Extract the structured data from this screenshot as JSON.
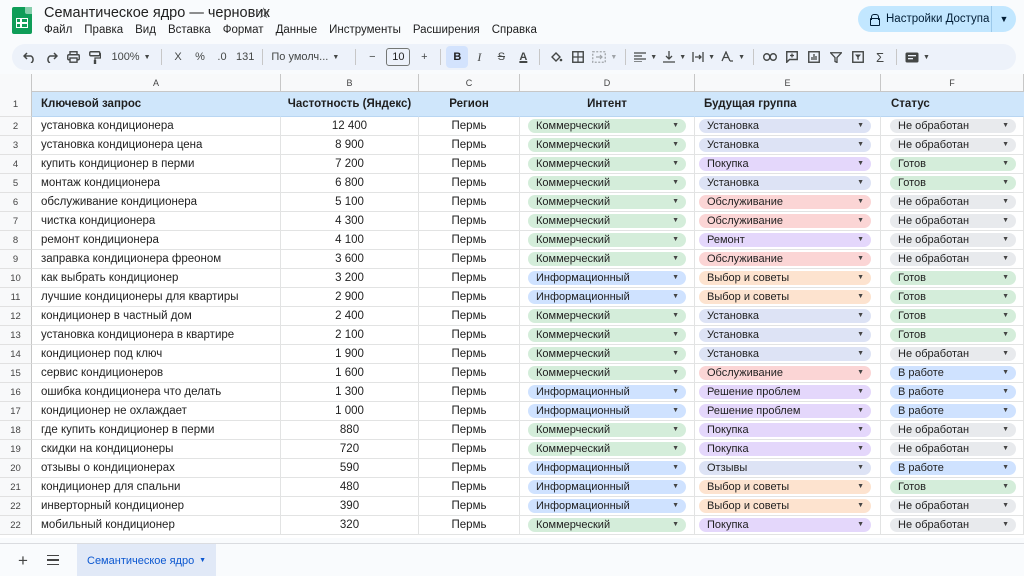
{
  "app": {
    "title": "Семантическое ядро — черновик",
    "menu": [
      "Файл",
      "Правка",
      "Вид",
      "Вставка",
      "Формат",
      "Данные",
      "Инструменты",
      "Расширения",
      "Справка"
    ],
    "share_label": "Настройки Доступа"
  },
  "toolbar": {
    "zoom": "100%",
    "currency": "X",
    "percent": "%",
    "decimals": ".0",
    "number_format": "131",
    "font": "По умолч...",
    "font_size": "10",
    "bold": "B",
    "italic": "I",
    "strike": "S",
    "text_color": "A"
  },
  "columns": [
    "A",
    "B",
    "C",
    "D",
    "E",
    "F"
  ],
  "header": {
    "num": "1",
    "keyword": "Ключевой запрос",
    "frequency": "Частотность (Яндекс)",
    "region": "Регион",
    "intent": "Интент",
    "group": "Будущая группа",
    "status": "Статус"
  },
  "chip_colors": {
    "Коммерческий": "#d4edda",
    "Информационный": "#cfe2ff",
    "Установка": "#dde3f5",
    "Покупка": "#e4d7fb",
    "Обслуживание": "#fbd5d5",
    "Ремонт": "#e4d7fb",
    "Выбор и советы": "#fde3cf",
    "Решение проблем": "#e4d7fb",
    "Отзывы": "#dde3f5",
    "Не обработан": "#e8eaed",
    "Готов": "#d4edda",
    "В работе": "#cfe2ff"
  },
  "rows": [
    {
      "num": "2",
      "keyword": "установка кондиционера",
      "frequency": "12 400",
      "region": "Пермь",
      "intent": "Коммерческий",
      "group": "Установка",
      "status": "Не обработан"
    },
    {
      "num": "3",
      "keyword": "установка кондиционера цена",
      "frequency": "8 900",
      "region": "Пермь",
      "intent": "Коммерческий",
      "group": "Установка",
      "status": "Не обработан"
    },
    {
      "num": "4",
      "keyword": "купить кондиционер в перми",
      "frequency": "7 200",
      "region": "Пермь",
      "intent": "Коммерческий",
      "group": "Покупка",
      "status": "Готов"
    },
    {
      "num": "5",
      "keyword": "монтаж кондиционера",
      "frequency": "6 800",
      "region": "Пермь",
      "intent": "Коммерческий",
      "group": "Установка",
      "status": "Готов"
    },
    {
      "num": "6",
      "keyword": "обслуживание кондиционера",
      "frequency": "5 100",
      "region": "Пермь",
      "intent": "Коммерческий",
      "group": "Обслуживание",
      "status": "Не обработан"
    },
    {
      "num": "7",
      "keyword": "чистка кондиционера",
      "frequency": "4 300",
      "region": "Пермь",
      "intent": "Коммерческий",
      "group": "Обслуживание",
      "status": "Не обработан"
    },
    {
      "num": "8",
      "keyword": "ремонт кондиционера",
      "frequency": "4 100",
      "region": "Пермь",
      "intent": "Коммерческий",
      "group": "Ремонт",
      "status": "Не обработан"
    },
    {
      "num": "9",
      "keyword": "заправка кондиционера фреоном",
      "frequency": "3 600",
      "region": "Пермь",
      "intent": "Коммерческий",
      "group": "Обслуживание",
      "status": "Не обработан"
    },
    {
      "num": "10",
      "keyword": "как выбрать кондиционер",
      "frequency": "3 200",
      "region": "Пермь",
      "intent": "Информационный",
      "group": "Выбор и советы",
      "status": "Готов"
    },
    {
      "num": "11",
      "keyword": "лучшие кондиционеры для квартиры",
      "frequency": "2 900",
      "region": "Пермь",
      "intent": "Информационный",
      "group": "Выбор и советы",
      "status": "Готов"
    },
    {
      "num": "12",
      "keyword": "кондиционер в частный дом",
      "frequency": "2 400",
      "region": "Пермь",
      "intent": "Коммерческий",
      "group": "Установка",
      "status": "Готов"
    },
    {
      "num": "13",
      "keyword": "установка кондиционера в квартире",
      "frequency": "2 100",
      "region": "Пермь",
      "intent": "Коммерческий",
      "group": "Установка",
      "status": "Готов"
    },
    {
      "num": "14",
      "keyword": "кондиционер под ключ",
      "frequency": "1 900",
      "region": "Пермь",
      "intent": "Коммерческий",
      "group": "Установка",
      "status": "Не обработан"
    },
    {
      "num": "15",
      "keyword": "сервис кондиционеров",
      "frequency": "1 600",
      "region": "Пермь",
      "intent": "Коммерческий",
      "group": "Обслуживание",
      "status": "В работе"
    },
    {
      "num": "16",
      "keyword": "ошибка кондиционера что делать",
      "frequency": "1 300",
      "region": "Пермь",
      "intent": "Информационный",
      "group": "Решение проблем",
      "status": "В работе"
    },
    {
      "num": "17",
      "keyword": "кондиционер не охлаждает",
      "frequency": "1 000",
      "region": "Пермь",
      "intent": "Информационный",
      "group": "Решение проблем",
      "status": "В работе"
    },
    {
      "num": "18",
      "keyword": "где купить кондиционер в перми",
      "frequency": "880",
      "region": "Пермь",
      "intent": "Коммерческий",
      "group": "Покупка",
      "status": "Не обработан"
    },
    {
      "num": "19",
      "keyword": "скидки на кондиционеры",
      "frequency": "720",
      "region": "Пермь",
      "intent": "Коммерческий",
      "group": "Покупка",
      "status": "Не обработан"
    },
    {
      "num": "20",
      "keyword": "отзывы о кондиционерах",
      "frequency": "590",
      "region": "Пермь",
      "intent": "Информационный",
      "group": "Отзывы",
      "status": "В работе"
    },
    {
      "num": "21",
      "keyword": "кондиционер для спальни",
      "frequency": "480",
      "region": "Пермь",
      "intent": "Информационный",
      "group": "Выбор и советы",
      "status": "Готов"
    },
    {
      "num": "22",
      "keyword": "инверторный кондиционер",
      "frequency": "390",
      "region": "Пермь",
      "intent": "Информационный",
      "group": "Выбор и советы",
      "status": "Не обработан"
    },
    {
      "num": "22",
      "keyword": "мобильный кондиционер",
      "frequency": "320",
      "region": "Пермь",
      "intent": "Коммерческий",
      "group": "Покупка",
      "status": "Не обработан"
    }
  ],
  "sheet_tab": "Семантическое ядро"
}
